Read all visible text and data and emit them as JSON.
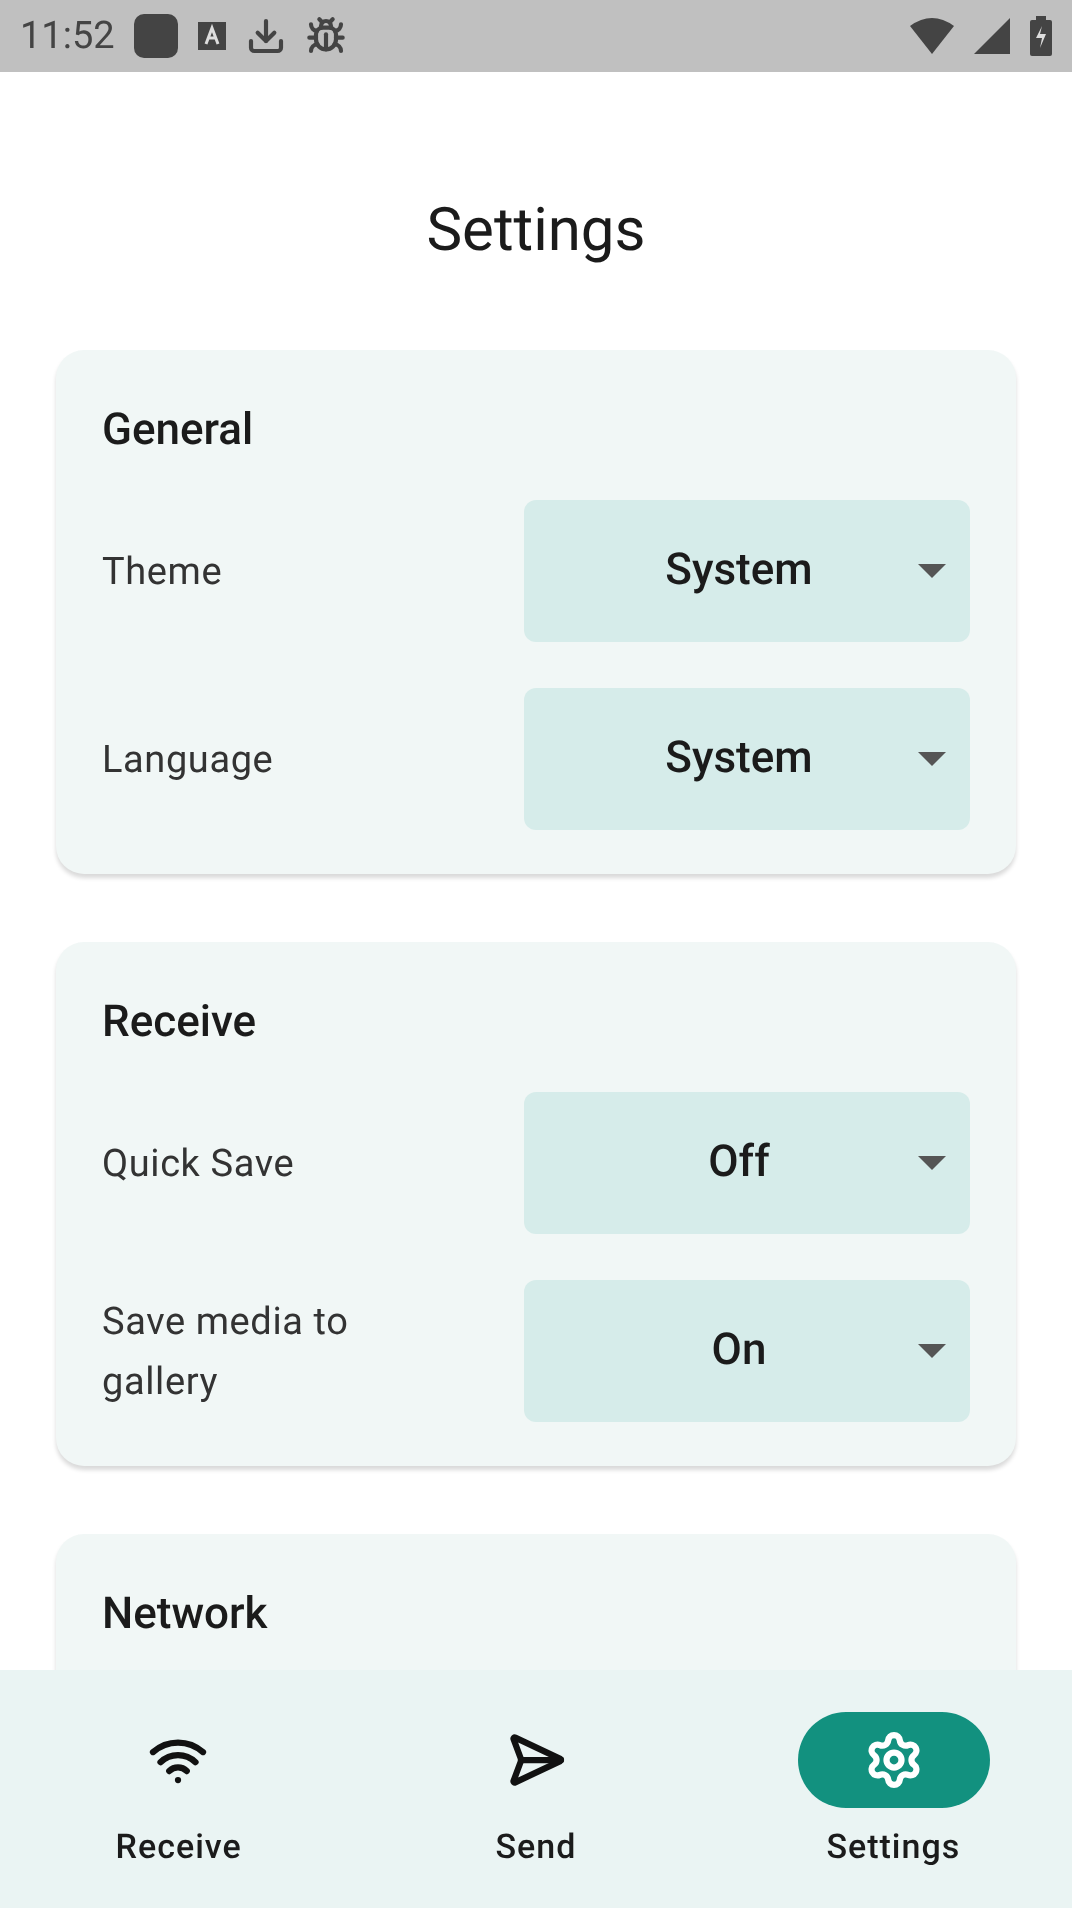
{
  "status_bar": {
    "time": "11:52"
  },
  "title": "Settings",
  "sections": [
    {
      "title": "General",
      "rows": [
        {
          "label": "Theme",
          "value": "System"
        },
        {
          "label": "Language",
          "value": "System"
        }
      ]
    },
    {
      "title": "Receive",
      "rows": [
        {
          "label": "Quick Save",
          "value": "Off"
        },
        {
          "label": "Save media to gallery",
          "value": "On"
        }
      ]
    },
    {
      "title": "Network"
    }
  ],
  "nav": [
    {
      "label": "Receive",
      "selected": false
    },
    {
      "label": "Send",
      "selected": false
    },
    {
      "label": "Settings",
      "selected": true
    }
  ]
}
